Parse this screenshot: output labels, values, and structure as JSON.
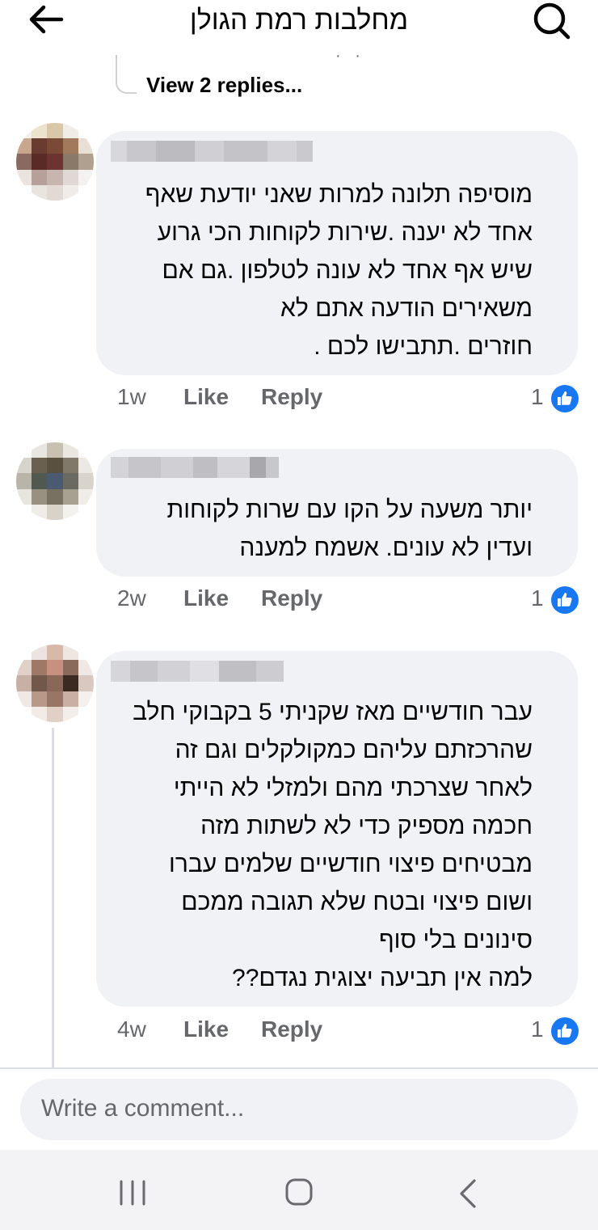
{
  "header": {
    "title": "מחלבות רמת הגולן"
  },
  "previous_thread": {
    "view_replies_label": "View 2 replies..."
  },
  "comments": [
    {
      "text": "מוסיפה תלונה למרות שאני יודעת שאף\nאחד לא יענה .שירות לקוחות הכי גרוע\nשיש אף אחד לא עונה לטלפון .גם אם\nמשאירים הודעה אתם לא\nחוזרים .תתבישו לכם .",
      "time": "1w",
      "like_label": "Like",
      "reply_label": "Reply",
      "reaction_count": "1"
    },
    {
      "text": "יותר משעה על הקו עם שרות לקוחות\nועדין לא עונים. אשמח למענה",
      "time": "2w",
      "like_label": "Like",
      "reply_label": "Reply",
      "reaction_count": "1"
    },
    {
      "text": "עבר חודשיים מאז שקניתי 5 בקבוקי חלב\nשהרכזתם עליהם כמקולקלים וגם זה\nלאחר שצרכתי מהם ולמזלי לא הייתי\nחכמה מספיק כדי לא לשתות מזה\nמבטיחים פיצוי חודשיים שלמים עברו\nושום פיצוי ובטח שלא תגובה ממכם\nסינונים בלי סוף\nלמה אין תביעה יצוגית נגדם??",
      "time": "4w",
      "like_label": "Like",
      "reply_label": "Reply",
      "reaction_count": "1"
    }
  ],
  "composer": {
    "placeholder": "Write a comment..."
  },
  "colors": {
    "accent": "#1877f2",
    "bubble": "#f0f2f5",
    "secondary_text": "#65676b"
  }
}
